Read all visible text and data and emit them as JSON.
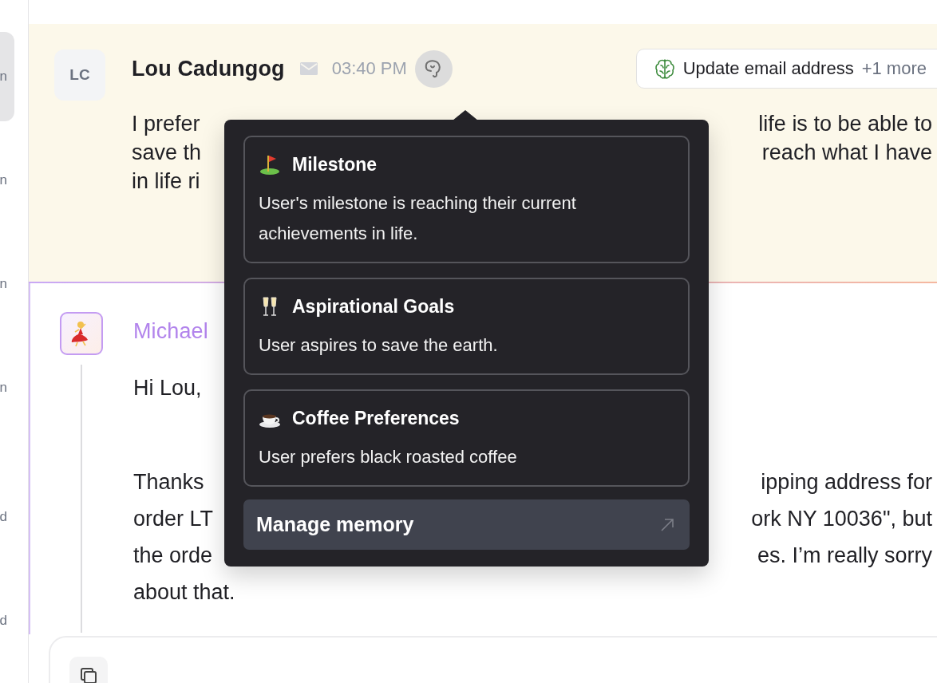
{
  "sidebar": {
    "items": [
      {
        "label": "n",
        "selected": true
      },
      {
        "label": "n",
        "selected": false
      },
      {
        "label": "n",
        "selected": false
      },
      {
        "label": "n",
        "selected": false
      },
      {
        "label": "d",
        "selected": false
      },
      {
        "label": "d",
        "selected": false
      }
    ]
  },
  "messages": [
    {
      "kind": "customer",
      "initials": "LC",
      "author": "Lou Cadungog",
      "email": true,
      "time": "03:40 PM",
      "memory_open": true,
      "suggestion": {
        "label": "Update email address",
        "more": "+1 more"
      },
      "paragraphs": [
        [
          [
            "I prefer",
            "life is to be able to"
          ],
          [
            "save th",
            "reach what I have"
          ],
          [
            "in life ri"
          ]
        ]
      ]
    },
    {
      "kind": "agent",
      "author": "Michael",
      "paragraphs": [
        [
          [
            "Hi Lou,"
          ]
        ],
        [
          [
            "Thanks",
            "ipping address for"
          ],
          [
            "order LT",
            "ork NY 10036\", but"
          ],
          [
            "the orde",
            "es. I’m really sorry"
          ],
          [
            "about that."
          ]
        ]
      ]
    }
  ],
  "memory": {
    "cards": [
      {
        "kind": "flag",
        "title": "Milestone",
        "text": "User's milestone is reaching their current achievements in life."
      },
      {
        "kind": "glasses",
        "title": "Aspirational Goals",
        "text": "User aspires to save the earth."
      },
      {
        "kind": "cup",
        "title": "Coffee Preferences",
        "text": "User prefers black roasted coffee"
      }
    ],
    "button": "Manage memory"
  }
}
